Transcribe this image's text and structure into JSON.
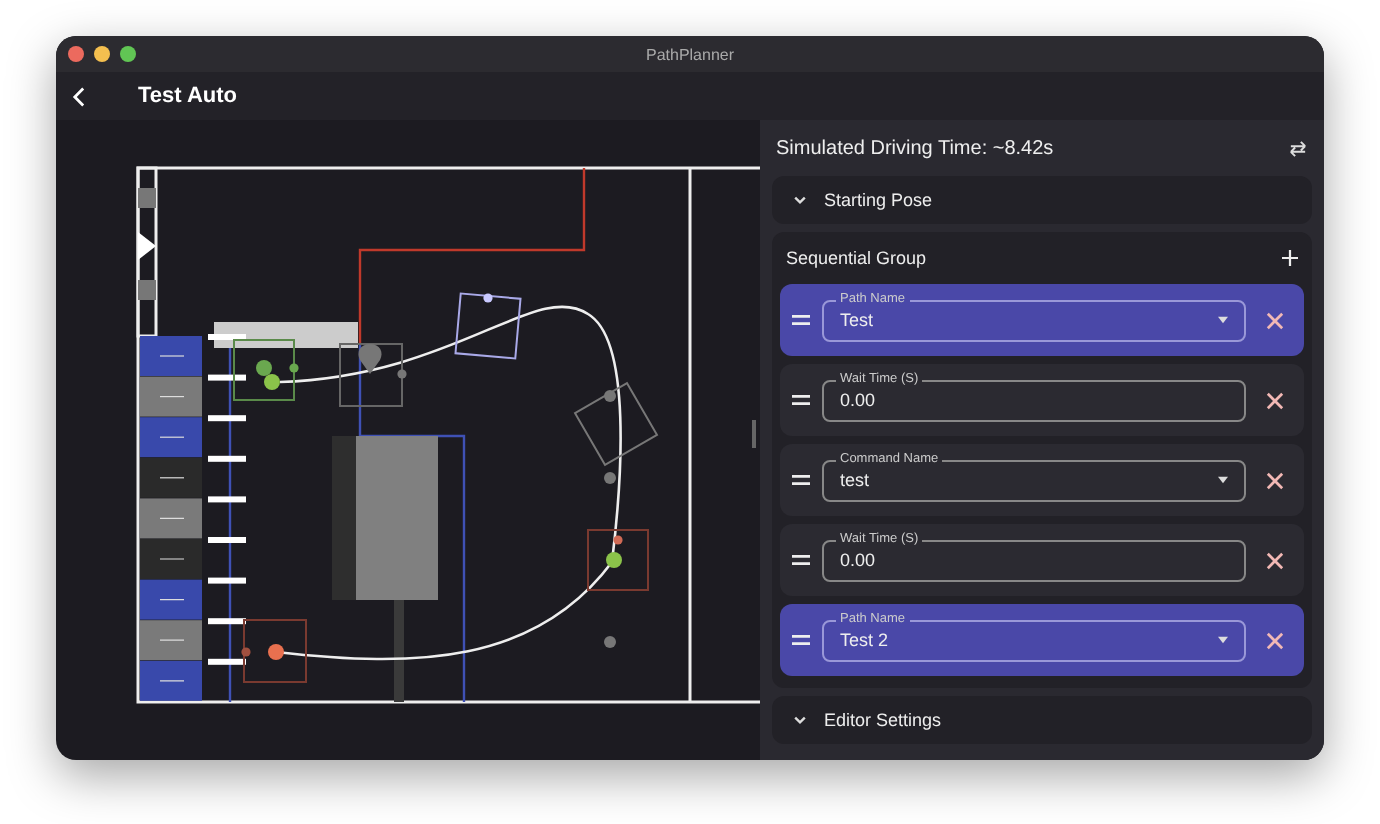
{
  "window": {
    "title": "PathPlanner"
  },
  "app_bar": {
    "title": "Test Auto"
  },
  "panel": {
    "header": "Simulated Driving Time: ~8.42s",
    "starting_pose": {
      "label": "Starting Pose",
      "expanded": false
    },
    "group": {
      "title": "Sequential Group",
      "items": [
        {
          "kind": "path",
          "label": "Path Name",
          "value": "Test"
        },
        {
          "kind": "wait",
          "label": "Wait Time (S)",
          "value": "0.00"
        },
        {
          "kind": "command",
          "label": "Command Name",
          "value": "test"
        },
        {
          "kind": "wait",
          "label": "Wait Time (S)",
          "value": "0.00"
        },
        {
          "kind": "path",
          "label": "Path Name",
          "value": "Test 2"
        }
      ]
    },
    "editor_settings": {
      "label": "Editor Settings",
      "expanded": false
    }
  }
}
